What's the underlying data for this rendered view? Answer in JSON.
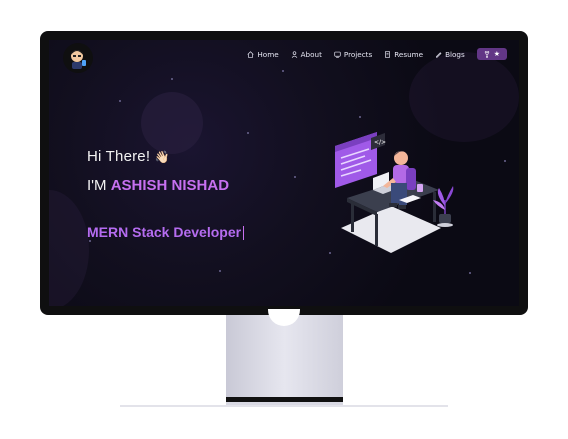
{
  "nav": {
    "home": "Home",
    "about": "About",
    "projects": "Projects",
    "resume": "Resume",
    "blogs": "Blogs",
    "star_button": "★"
  },
  "hero": {
    "greeting": "Hi There!",
    "wave_emoji": "👋🏻",
    "prefix": "I'M",
    "name": "ASHISH NISHAD",
    "role": "MERN Stack Developer"
  },
  "icons": {
    "home": "home-icon",
    "about": "user-icon",
    "projects": "projects-icon",
    "resume": "document-icon",
    "blogs": "pen-icon",
    "fork": "fork-icon",
    "star": "star-icon"
  },
  "colors": {
    "accent": "#c770f0",
    "nav_button": "#623686",
    "background": "#0b0a14"
  }
}
